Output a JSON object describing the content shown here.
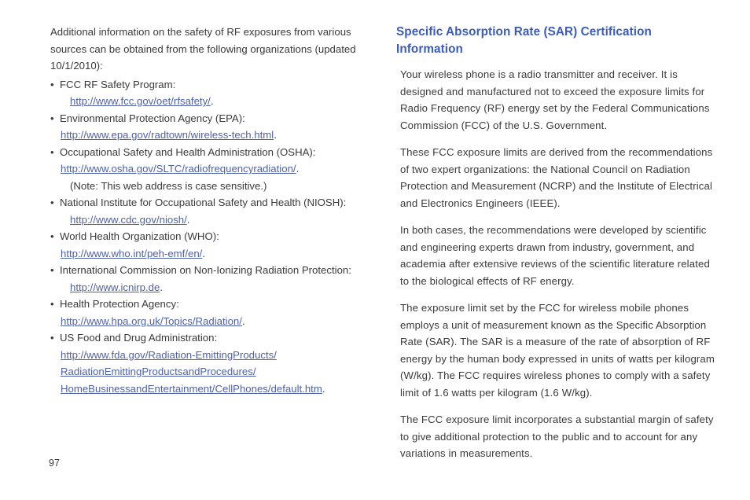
{
  "colors": {
    "body_text": "#3a3a3a",
    "heading_blue": "#3b5bbf",
    "link_blue": "#4f62a8",
    "background": "#ffffff"
  },
  "left_column": {
    "intro": "Additional information on the safety of RF exposures from various sources can be obtained from the following organizations (updated 10/1/2010):",
    "bullets": [
      {
        "label": "FCC RF Safety Program:",
        "link": "http://www.fcc.gov/oet/rfsafety/",
        "link_suffix": ".",
        "link_indented": true,
        "note": ""
      },
      {
        "label": "Environmental Protection Agency (EPA):",
        "link": "http://www.epa.gov/radtown/wireless-tech.html",
        "link_suffix": ".",
        "link_indented": false,
        "note": ""
      },
      {
        "label": "Occupational Safety and Health Administration (OSHA):",
        "link": "http://www.osha.gov/SLTC/radiofrequencyradiation/",
        "link_suffix": ".",
        "link_indented": false,
        "note": "(Note: This web address is case sensitive.)"
      },
      {
        "label": "National Institute for Occupational Safety and Health (NIOSH):",
        "link": "http://www.cdc.gov/niosh/",
        "link_suffix": ".",
        "link_indented": true,
        "note": ""
      },
      {
        "label": "World Health Organization (WHO):",
        "link": "http://www.who.int/peh-emf/en/",
        "link_suffix": ".",
        "link_indented": false,
        "note": ""
      },
      {
        "label": "International Commission on Non-Ionizing Radiation Protection:",
        "link": "http://www.icnirp.de",
        "link_suffix": ".",
        "link_indented": true,
        "note": ""
      },
      {
        "label": "Health Protection Agency:",
        "link": "http://www.hpa.org.uk/Topics/Radiation/",
        "link_suffix": ".",
        "link_indented": false,
        "note": ""
      },
      {
        "label": "US Food and Drug Administration:",
        "link_lines": [
          "http://www.fda.gov/Radiation-EmittingProducts/",
          "RadiationEmittingProductsandProcedures/",
          "HomeBusinessandEntertainment/CellPhones/default.htm"
        ],
        "link_suffix": ".",
        "link_indented": false,
        "note": ""
      }
    ]
  },
  "right_column": {
    "heading": "Specific Absorption Rate (SAR) Certification Information",
    "paragraphs": [
      "Your wireless phone is a radio transmitter and receiver. It is designed and manufactured not to exceed the exposure limits for Radio Frequency (RF) energy set by the Federal Communications Commission (FCC) of the U.S. Government.",
      "These FCC exposure limits are derived from the recommendations of two expert organizations: the National Council on Radiation Protection and Measurement (NCRP) and the Institute of Electrical and Electronics Engineers (IEEE).",
      "In both cases, the recommendations were developed by scientific and engineering experts drawn from industry, government, and academia after extensive reviews of the scientific literature related to the biological effects of RF energy.",
      "The exposure limit set by the FCC for wireless mobile phones employs a unit of measurement known as the Specific Absorption Rate (SAR). The SAR is a measure of the rate of absorption of RF energy by the human body expressed in units of watts per kilogram (W/kg). The FCC requires wireless phones to comply with a safety limit of 1.6 watts per kilogram (1.6 W/kg).",
      "The FCC exposure limit incorporates a substantial margin of safety to give additional protection to the public and to account for any variations in measurements."
    ]
  },
  "footer": {
    "page_number": "97"
  }
}
